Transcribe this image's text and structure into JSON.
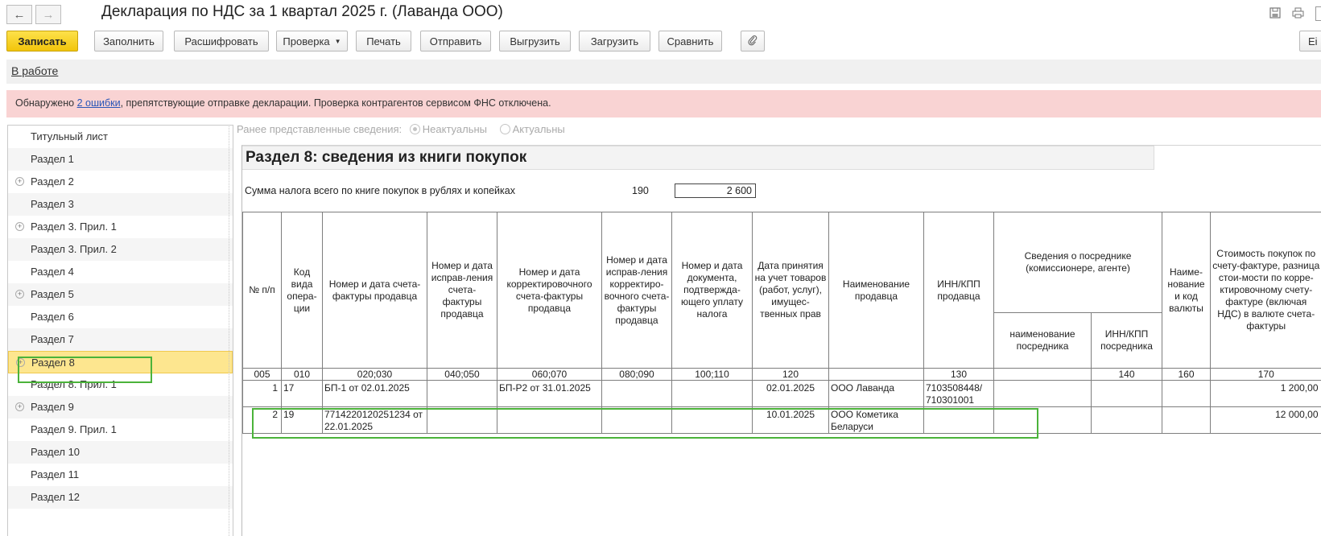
{
  "window": {
    "title": "Декларация по НДС за 1 квартал 2025 г. (Лаванда ООО)"
  },
  "toolbar": {
    "save": "Записать",
    "fill": "Заполнить",
    "decode": "Расшифровать",
    "check": "Проверка",
    "print": "Печать",
    "send": "Отправить",
    "export": "Выгрузить",
    "import": "Загрузить",
    "compare": "Сравнить",
    "more": "Ei"
  },
  "status": {
    "link": "В работе"
  },
  "alert": {
    "prefix": "Обнаружено ",
    "link": "2 ошибки",
    "suffix": ", препятствующие отправке декларации. Проверка контрагентов сервисом ФНС отключена."
  },
  "sidebar": {
    "items": [
      {
        "label": "Титульный лист"
      },
      {
        "label": "Раздел 1"
      },
      {
        "label": "Раздел 2"
      },
      {
        "label": "Раздел 3"
      },
      {
        "label": "Раздел 3. Прил. 1"
      },
      {
        "label": "Раздел 3. Прил. 2"
      },
      {
        "label": "Раздел 4"
      },
      {
        "label": "Раздел 5"
      },
      {
        "label": "Раздел 6"
      },
      {
        "label": "Раздел 7"
      },
      {
        "label": "Раздел 8"
      },
      {
        "label": "Раздел 8. Прил. 1"
      },
      {
        "label": "Раздел 9"
      },
      {
        "label": "Раздел 9. Прил. 1"
      },
      {
        "label": "Раздел 10"
      },
      {
        "label": "Раздел 11"
      },
      {
        "label": "Раздел 12"
      }
    ],
    "active": "Раздел 8"
  },
  "previous_info": {
    "label": "Ранее представленные сведения:",
    "option_outdated": "Неактуальны",
    "option_actual": "Актуальны",
    "selected": "Неактуальны"
  },
  "section": {
    "title": "Раздел 8: сведения из книги покупок",
    "sum_label": "Сумма налога всего по книге покупок в рублях и копейках",
    "sum_code": "190",
    "sum_value": "2 600"
  },
  "table": {
    "headers": {
      "num": "№ п/п",
      "op_code": "Код вида опера-ции",
      "invoice": "Номер и дата счета-фактуры продавца",
      "fix": "Номер и дата исправ-ления счета-фактуры продавца",
      "corr": "Номер и дата корректировочного счета-фактуры продавца",
      "corr_fix": "Номер и дата исправ-ления корректиро-вочного счета-фактуры продавца",
      "pay_doc": "Номер и дата документа, подтвержда-ющего уплату налога",
      "accept_date": "Дата принятия на учет товаров (работ, услуг), имущес-твенных прав",
      "seller_name": "Наименование продавца",
      "seller_inn": "ИНН/КПП продавца",
      "agent": "Сведения о посреднике (комиссионере, агенте)",
      "agent_name": "наименование посредника",
      "agent_inn": "ИНН/КПП посредника",
      "currency": "Наиме-нование и код валюты",
      "cost": "Стоимость покупок по счету-фактуре, разница стои-мости по корре-ктировочному счету-фактуре (включая НДС) в валюте счета-фактуры"
    },
    "codes": [
      "005",
      "010",
      "020;030",
      "040;050",
      "060;070",
      "080;090",
      "100;110",
      "120",
      "",
      "130",
      "",
      "140",
      "160",
      "170"
    ],
    "rows": [
      {
        "num": "1",
        "op_code": "17",
        "invoice": "БП-1 от 02.01.2025",
        "fix": "",
        "corr": "БП-Р2 от 31.01.2025",
        "corr_fix": "",
        "pay_doc": "",
        "accept_date": "02.01.2025",
        "seller_name": "ООО Лаванда",
        "seller_inn": "7103508448/ 710301001",
        "agent_name": "",
        "agent_inn": "",
        "currency": "",
        "cost": "1 200,00"
      },
      {
        "num": "2",
        "op_code": "19",
        "invoice": "7714220120251234 от 22.01.2025",
        "fix": "",
        "corr": "",
        "corr_fix": "",
        "pay_doc": "",
        "accept_date": "10.01.2025",
        "seller_name": "ООО Кометика Беларуси",
        "seller_inn": "",
        "agent_name": "",
        "agent_inn": "",
        "currency": "",
        "cost": "12 000,00"
      }
    ]
  },
  "icons": {
    "back": "arrow-left-icon",
    "forward": "arrow-right-icon",
    "save_file": "floppy-icon",
    "print": "printer-icon",
    "attach": "paperclip-icon",
    "expand": "plus-circle-icon",
    "dropdown": "caret-down-icon"
  },
  "colors": {
    "primary_button": "#f5cc17",
    "alert_background": "#f9d3d3",
    "active_item": "#fde68f",
    "highlight": "#4bb33a",
    "link": "#2a56b8"
  }
}
